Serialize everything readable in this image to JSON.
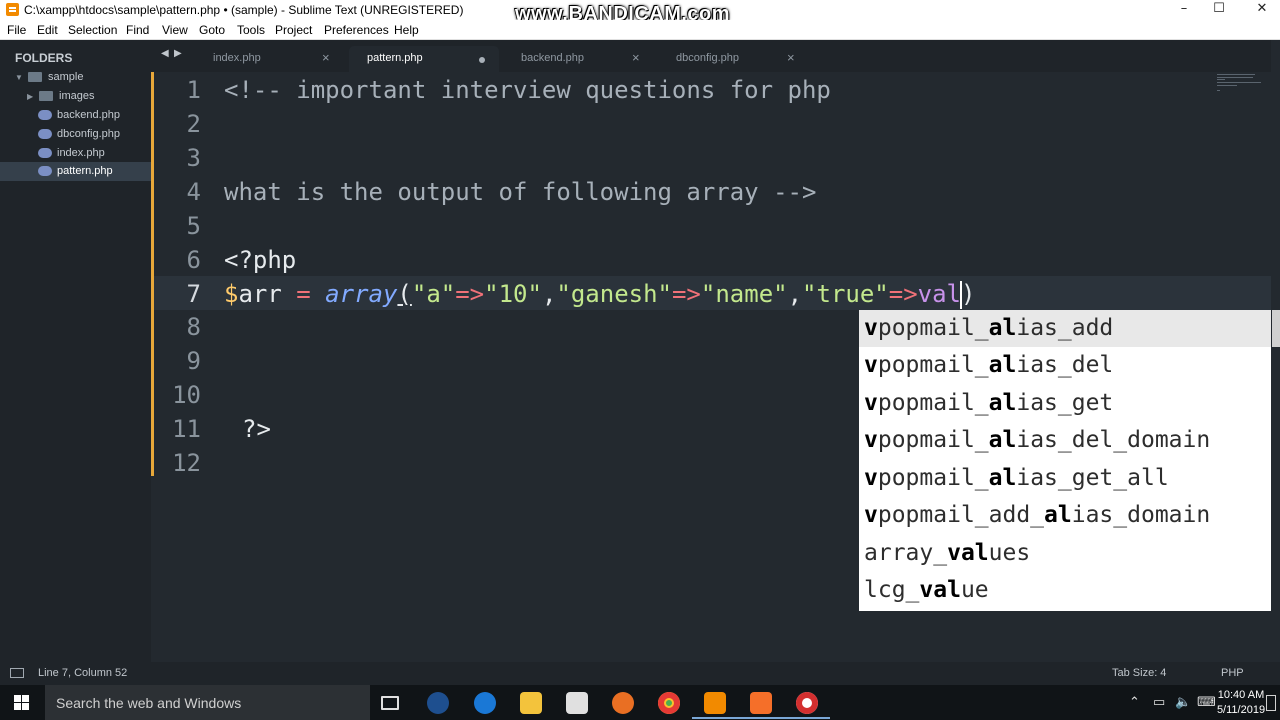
{
  "window": {
    "title": "C:\\xampp\\htdocs\\sample\\pattern.php • (sample) - Sublime Text (UNREGISTERED)",
    "watermark": "www.BANDICAM.com",
    "controls": {
      "minimize": "–",
      "maximize": "☐",
      "close": "✕"
    }
  },
  "menu": [
    "File",
    "Edit",
    "Selection",
    "Find",
    "View",
    "Goto",
    "Tools",
    "Project",
    "Preferences",
    "Help"
  ],
  "sidebar": {
    "header": "FOLDERS",
    "items": [
      {
        "label": "sample",
        "type": "folder",
        "expanded": true
      },
      {
        "label": "images",
        "type": "folder",
        "expanded": false
      },
      {
        "label": "backend.php",
        "type": "php-file"
      },
      {
        "label": "dbconfig.php",
        "type": "php-file"
      },
      {
        "label": "index.php",
        "type": "php-file"
      },
      {
        "label": "pattern.php",
        "type": "php-file",
        "selected": true
      }
    ]
  },
  "tabs": [
    {
      "label": "index.php",
      "active": false,
      "dirty": false
    },
    {
      "label": "pattern.php",
      "active": true,
      "dirty": true
    },
    {
      "label": "backend.php",
      "active": false,
      "dirty": false
    },
    {
      "label": "dbconfig.php",
      "active": false,
      "dirty": false
    }
  ],
  "editor": {
    "line_numbers": [
      "1",
      "2",
      "3",
      "4",
      "5",
      "6",
      "7",
      "8",
      "9",
      "10",
      "11",
      "12"
    ],
    "current_line": 7,
    "lines": {
      "l1": "<!-- important interview questions for php",
      "l4": "what is the output of following array -->",
      "l6": "<?php",
      "l7": {
        "dollar": "$",
        "var": "arr",
        "eq": " = ",
        "func": "array",
        "open": "(",
        "s1": "\"a\"",
        "arrow1": "=>",
        "s2": "\"10\"",
        "comma1": ",",
        "s3": "\"ganesh\"",
        "arrow2": "=>",
        "s4": "\"name\"",
        "comma2": ",",
        "s5": "\"true\"",
        "arrow3": "=>",
        "typed": "val",
        "close": ")"
      },
      "l11": "?>"
    }
  },
  "autocomplete": {
    "items": [
      {
        "pre": "v",
        "b1": "",
        "mid": "popmail_",
        "b2": "al",
        "post": "ias_add",
        "selected": true
      },
      {
        "pre": "v",
        "b1": "",
        "mid": "popmail_",
        "b2": "al",
        "post": "ias_del"
      },
      {
        "pre": "v",
        "b1": "",
        "mid": "popmail_",
        "b2": "al",
        "post": "ias_get"
      },
      {
        "pre": "v",
        "b1": "",
        "mid": "popmail_",
        "b2": "al",
        "post": "ias_del_domain"
      },
      {
        "pre": "v",
        "b1": "",
        "mid": "popmail_",
        "b2": "al",
        "post": "ias_get_all"
      },
      {
        "pre": "v",
        "b1": "",
        "mid": "popmail_add_",
        "b2": "al",
        "post": "ias_domain"
      },
      {
        "pre": "",
        "b1": "",
        "mid": "array_",
        "b2": "val",
        "post": "ues"
      },
      {
        "pre": "",
        "b1": "",
        "mid": "lcg_",
        "b2": "val",
        "post": "ue"
      }
    ]
  },
  "status": {
    "position": "Line 7, Column 52",
    "tab_size": "Tab Size: 4",
    "syntax": "PHP"
  },
  "taskbar": {
    "search_placeholder": "Search the web and Windows",
    "apps": [
      "task-view",
      "globe",
      "edge",
      "file-explorer",
      "store",
      "firefox",
      "chrome",
      "sublime-text",
      "xampp",
      "bandicam"
    ],
    "time": "10:40 AM",
    "date": "5/11/2019",
    "tray_icons": [
      "chevron-up",
      "network",
      "volume",
      "keyboard",
      "notifications"
    ]
  },
  "colors": {
    "editor_bg": "#23292f",
    "sidebar_bg": "#1f2429",
    "fold_accent": "#e8a83a",
    "string": "#c3e88d",
    "operator": "#f07178",
    "function": "#82aaff"
  }
}
